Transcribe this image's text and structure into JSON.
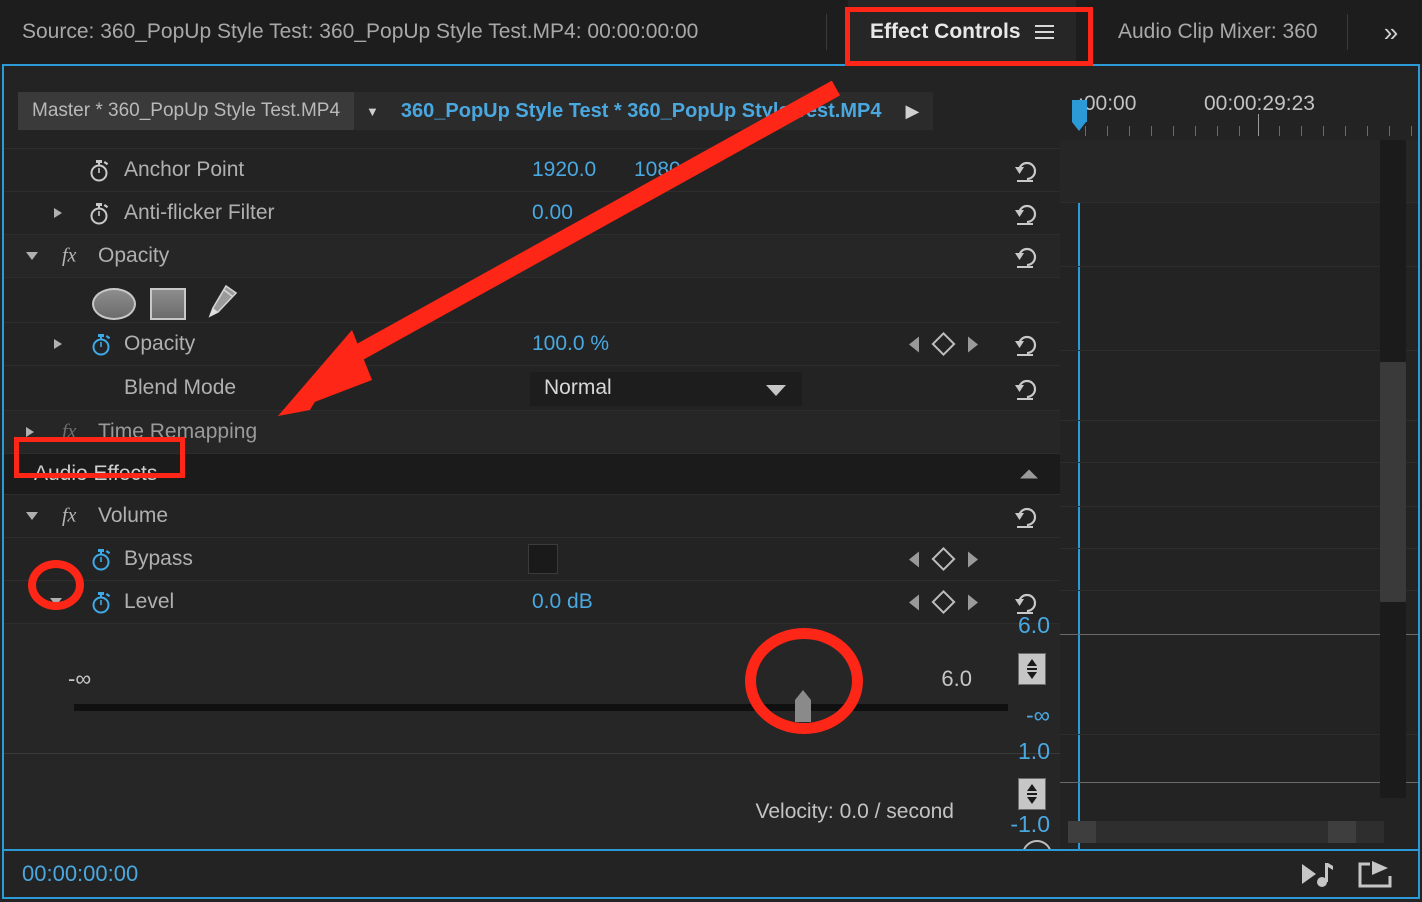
{
  "tabs": [
    {
      "label": "Source: 360_PopUp Style Test: 360_PopUp Style Test.MP4: 00:00:00:00",
      "active": false,
      "name": "tab-source"
    },
    {
      "label": "Effect Controls",
      "active": true,
      "name": "tab-effect-controls"
    },
    {
      "label": "Audio Clip Mixer: 360",
      "active": false,
      "name": "tab-audio-clip-mixer"
    }
  ],
  "tab_overflow_icon": "chevron-double-right-icon",
  "tab_menu_icon": "panel-menu-icon",
  "clip_header": {
    "master_label": "Master * 360_PopUp Style Test.MP4",
    "caret_icon": "chevron-down-icon",
    "clip_label": "360_PopUp Style Test * 360_PopUp Style Test.MP4",
    "forward_icon": "play-arrow-icon"
  },
  "timeline": {
    "start_time": ":00:00",
    "end_time": "00:00:29:23",
    "playhead_position": "00:00:00:00"
  },
  "video_effects": {
    "rows": [
      {
        "name": "anchor-point",
        "label": "Anchor Point",
        "values": [
          "1920.0",
          "1080.0"
        ],
        "stopwatch": "grey",
        "disclosure": "none",
        "reset": true,
        "keyframe_nav": false
      },
      {
        "name": "anti-flicker-filter",
        "label": "Anti-flicker Filter",
        "values": [
          "0.00"
        ],
        "stopwatch": "grey",
        "disclosure": "closed",
        "reset": true,
        "keyframe_nav": false
      },
      {
        "name": "opacity-effect",
        "label": "Opacity",
        "fx": true,
        "disclosure": "open",
        "reset": true,
        "keyframe_nav": false
      },
      {
        "name": "opacity-param",
        "label": "Opacity",
        "values": [
          "100.0 %"
        ],
        "stopwatch": "blue",
        "disclosure": "closed",
        "reset": true,
        "keyframe_nav": true
      },
      {
        "name": "blend-mode",
        "label": "Blend Mode",
        "select_value": "Normal",
        "reset": true,
        "keyframe_nav": false
      },
      {
        "name": "time-remapping",
        "label": "Time Remapping",
        "fx": true,
        "dim": true,
        "disclosure": "closed",
        "reset": false,
        "keyframe_nav": false
      }
    ],
    "mask_tools": [
      {
        "name": "create-ellipse-mask-icon",
        "label": "ellipse-mask-icon"
      },
      {
        "name": "create-rectangle-mask-icon",
        "label": "rectangle-mask-icon"
      },
      {
        "name": "free-draw-bezier-icon",
        "label": "pen-tool-icon"
      }
    ]
  },
  "audio_effects": {
    "section_label": "Audio Effects",
    "collapse_icon": "triangle-up-icon",
    "rows": [
      {
        "name": "volume-effect",
        "label": "Volume",
        "fx": true,
        "disclosure": "open",
        "reset": true,
        "keyframe_nav": false
      },
      {
        "name": "bypass-param",
        "label": "Bypass",
        "stopwatch": "blue",
        "checkbox": true,
        "keyframe_nav": true,
        "reset": false
      },
      {
        "name": "level-param",
        "label": "Level",
        "values": [
          "0.0 dB"
        ],
        "stopwatch": "blue",
        "disclosure": "open",
        "keyframe_nav": true,
        "reset": true
      }
    ],
    "level_graph": {
      "min_label": "-∞",
      "max_label": "6.0",
      "scale_top": "6.0",
      "scale_bottom": "-∞",
      "stepper_icon": "vertical-resize-icon"
    },
    "velocity_graph": {
      "velocity_label": "Velocity: 0.0 / second",
      "scale_top": "1.0",
      "scale_bottom": "-1.0",
      "stepper_icon": "vertical-resize-icon"
    }
  },
  "footer": {
    "timecode": "00:00:00:00",
    "icons": [
      {
        "name": "play-audio-only-icon"
      },
      {
        "name": "export-frame-icon"
      }
    ]
  },
  "colors": {
    "accent_blue": "#4aa8e0",
    "panel_border": "#2b9ad6",
    "annotation_red": "#fe2616",
    "panel_bg": "#232323",
    "row_alt_bg": "#262626"
  },
  "annotations": [
    {
      "name": "annotation-box-effect-controls-tab",
      "shape": "box"
    },
    {
      "name": "annotation-box-audio-effects",
      "shape": "box"
    },
    {
      "name": "annotation-ellipse-level-disclosure",
      "shape": "ellipse"
    },
    {
      "name": "annotation-ellipse-level-slider-thumb",
      "shape": "ellipse"
    },
    {
      "name": "annotation-arrow-to-time-remapping",
      "shape": "arrow"
    }
  ]
}
